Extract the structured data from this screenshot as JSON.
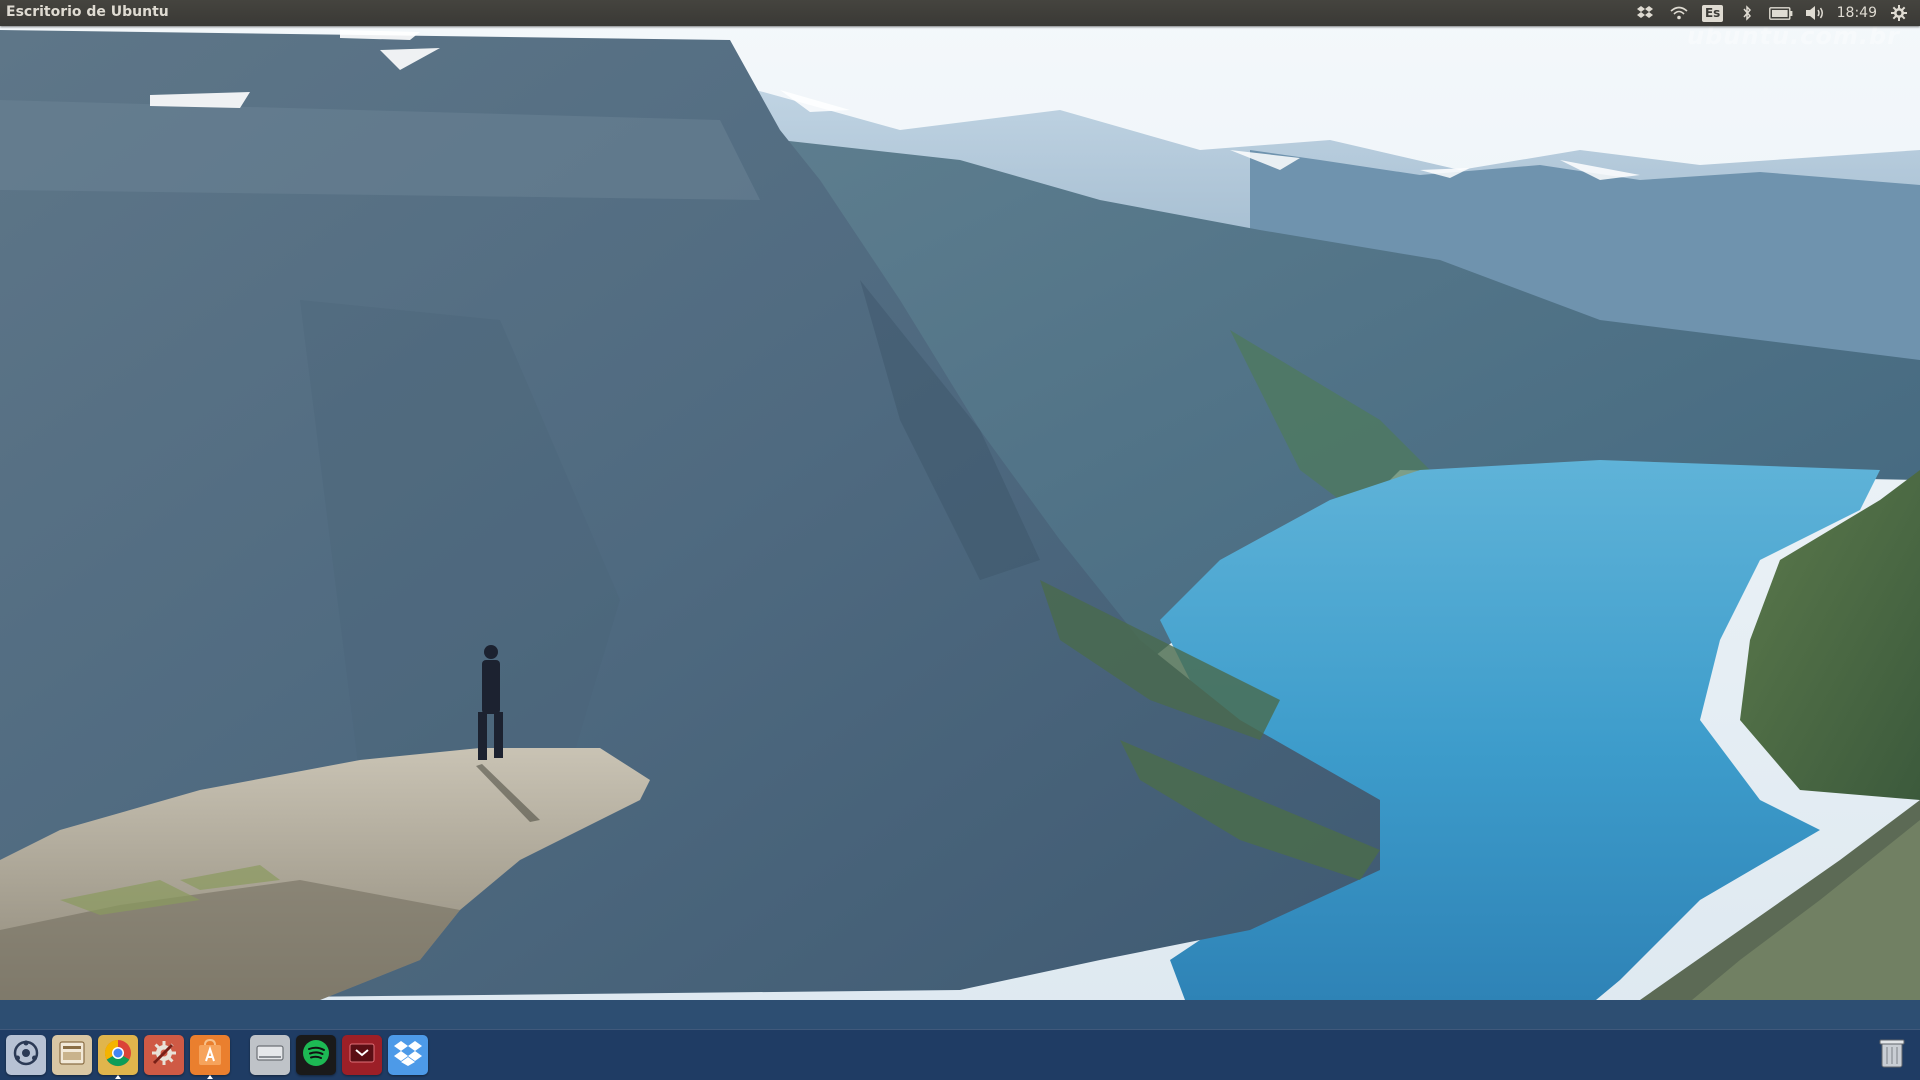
{
  "top_panel": {
    "window_title": "Escritorio de Ubuntu",
    "indicators": {
      "dropbox_icon": "dropbox-icon",
      "network_icon": "wifi-icon",
      "keyboard_layout": "Es",
      "bluetooth_icon": "bluetooth-icon",
      "battery_icon": "battery-icon",
      "sound_icon": "volume-icon",
      "clock": "18:49",
      "session_icon": "gear-icon"
    }
  },
  "wallpaper": {
    "description_icon": "landscape-wallpaper",
    "watermark": "ubuntu.com.br"
  },
  "launcher": {
    "items": [
      {
        "icon": "dash-home-icon",
        "color": "#8a9bb5"
      },
      {
        "icon": "files-icon",
        "color": "#c9b89a"
      },
      {
        "icon": "chrome-icon",
        "color": "#d7a640"
      },
      {
        "icon": "system-settings-icon",
        "color": "#c04a3a"
      },
      {
        "icon": "software-center-icon",
        "color": "#e8782c"
      },
      {
        "icon": "drive-icon",
        "color": "#cccccc"
      },
      {
        "icon": "spotify-icon",
        "color": "#1db954"
      },
      {
        "icon": "media-app-icon",
        "color": "#b0202a"
      },
      {
        "icon": "dropbox-icon",
        "color": "#3d8be2"
      }
    ],
    "trash_icon": "trash-icon"
  }
}
